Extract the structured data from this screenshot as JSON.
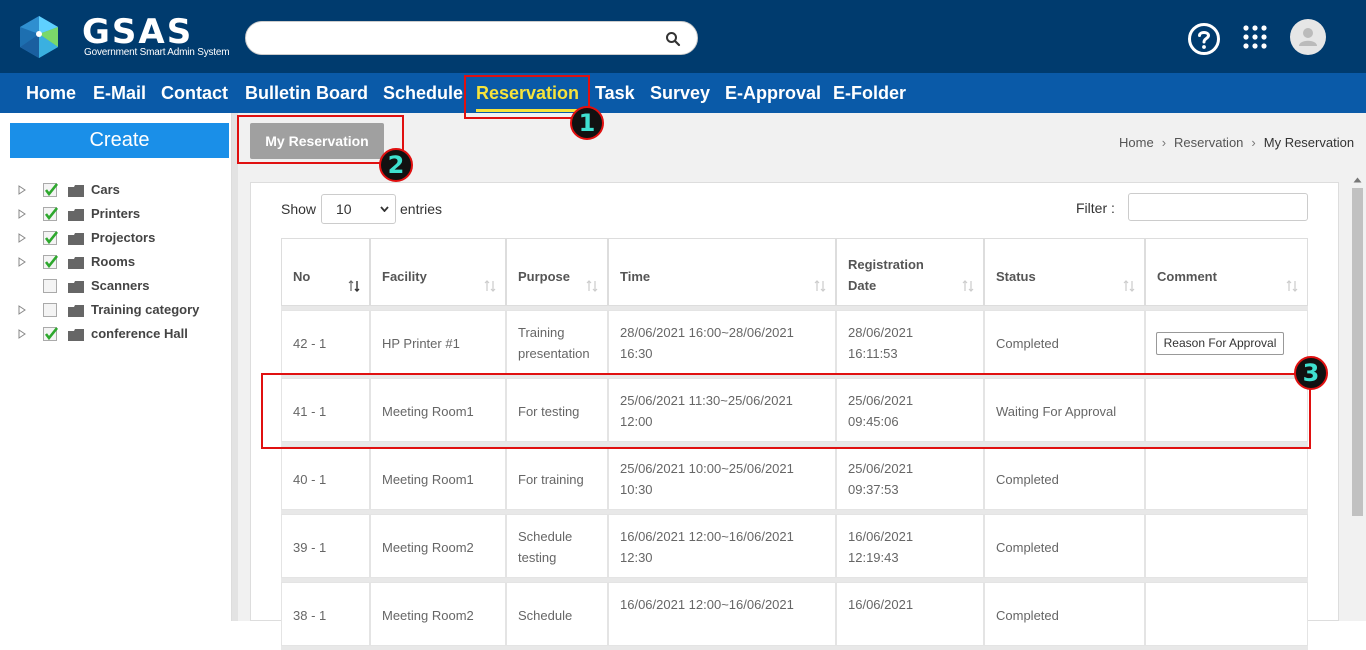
{
  "header": {
    "logo_text": "GSAS",
    "logo_subtitle": "Government Smart Admin System",
    "search_placeholder": ""
  },
  "nav": {
    "items": [
      {
        "label": "Home"
      },
      {
        "label": "E-Mail"
      },
      {
        "label": "Contact"
      },
      {
        "label": "Bulletin Board"
      },
      {
        "label": "Schedule"
      },
      {
        "label": "Reservation",
        "active": true
      },
      {
        "label": "Task"
      },
      {
        "label": "Survey"
      },
      {
        "label": "E-Approval"
      },
      {
        "label": "E-Folder"
      }
    ]
  },
  "markers": [
    "1",
    "2",
    "3"
  ],
  "sidebar": {
    "create_label": "Create",
    "tree": [
      {
        "label": "Cars",
        "checked": true,
        "expandable": true
      },
      {
        "label": "Printers",
        "checked": true,
        "expandable": true
      },
      {
        "label": "Projectors",
        "checked": true,
        "expandable": true
      },
      {
        "label": "Rooms",
        "checked": true,
        "expandable": true
      },
      {
        "label": "Scanners",
        "checked": false,
        "expandable": false
      },
      {
        "label": "Training category",
        "checked": false,
        "expandable": true
      },
      {
        "label": "conference Hall",
        "checked": true,
        "expandable": true
      }
    ]
  },
  "toolbar": {
    "my_reservation_label": "My Reservation"
  },
  "breadcrumb": {
    "items": [
      "Home",
      "Reservation",
      "My Reservation"
    ]
  },
  "table_controls": {
    "show_label": "Show",
    "entries_value": "10",
    "entries_label": "entries",
    "filter_label": "Filter :"
  },
  "table": {
    "headers": [
      {
        "line1": "No",
        "line2": ""
      },
      {
        "line1": "Facility",
        "line2": ""
      },
      {
        "line1": "Purpose",
        "line2": ""
      },
      {
        "line1": "Time",
        "line2": ""
      },
      {
        "line1": "Registration",
        "line2": "Date"
      },
      {
        "line1": "Status",
        "line2": ""
      },
      {
        "line1": "Comment",
        "line2": ""
      }
    ],
    "rows": [
      {
        "no": "42 - 1",
        "facility": "HP Printer #1",
        "purpose1": "Training",
        "purpose2": "presentation",
        "time1": "28/06/2021 16:00~28/06/2021",
        "time2": "16:30",
        "reg1": "28/06/2021",
        "reg2": "16:11:53",
        "status": "Completed",
        "comment": "Reason For Approval"
      },
      {
        "no": "41 - 1",
        "facility": "Meeting Room1",
        "purpose1": "For testing",
        "purpose2": "",
        "time1": "25/06/2021 11:30~25/06/2021",
        "time2": "12:00",
        "reg1": "25/06/2021",
        "reg2": "09:45:06",
        "status": "Waiting For Approval",
        "comment": ""
      },
      {
        "no": "40 - 1",
        "facility": "Meeting Room1",
        "purpose1": "For training",
        "purpose2": "",
        "time1": "25/06/2021 10:00~25/06/2021",
        "time2": "10:30",
        "reg1": "25/06/2021",
        "reg2": "09:37:53",
        "status": "Completed",
        "comment": ""
      },
      {
        "no": "39 - 1",
        "facility": "Meeting Room2",
        "purpose1": "Schedule",
        "purpose2": "testing",
        "time1": "16/06/2021 12:00~16/06/2021",
        "time2": "12:30",
        "reg1": "16/06/2021",
        "reg2": "12:19:43",
        "status": "Completed",
        "comment": ""
      },
      {
        "no": "38 - 1",
        "facility": "Meeting Room2",
        "purpose1": "Schedule",
        "purpose2": "",
        "time1": "16/06/2021 12:00~16/06/2021",
        "time2": "",
        "reg1": "16/06/2021",
        "reg2": "",
        "status": "Completed",
        "comment": ""
      }
    ]
  },
  "colors": {
    "topbar": "#003b6e",
    "navbar": "#0a5aa8",
    "nav_active": "#f6e33b",
    "create_button": "#1a8fe8",
    "annotation_red": "#e01010",
    "marker_text": "#3fe0d0"
  }
}
